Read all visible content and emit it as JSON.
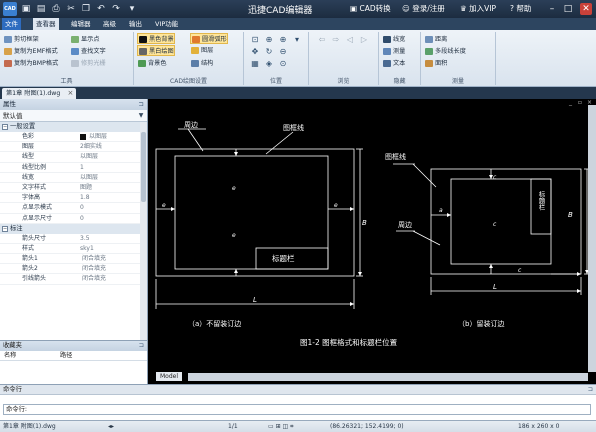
{
  "app": {
    "title": "迅捷CAD编辑器",
    "logo_text": "CAD",
    "title_buttons": [
      "CAD转换",
      "登录/注册",
      "加入VIP",
      "帮助"
    ],
    "window_controls": [
      "minimize-icon",
      "maximize-icon",
      "close-icon"
    ]
  },
  "menu": [
    "文件",
    "查看器",
    "编辑器",
    "高级",
    "输出",
    "VIP功能"
  ],
  "ribbon": {
    "tools": {
      "title": "工具",
      "buttons": [
        "剪切框架",
        "显示点",
        "复制为EMF格式",
        "查找文字",
        "复制为BMP格式",
        "修剪光栅"
      ]
    },
    "cad_settings": {
      "title": "CAD绘图设置",
      "buttons": [
        "黑色背景",
        "圆滑弧形",
        "黑白绘图",
        "图层",
        "背景色",
        "结构"
      ]
    },
    "position": {
      "title": "位置"
    },
    "browse": {
      "title": "浏览"
    },
    "hide": {
      "title": "隐藏",
      "buttons": [
        "线宽",
        "测量",
        "文本"
      ]
    },
    "measure": {
      "title": "测量",
      "buttons": [
        "距离",
        "多段线长度",
        "面积"
      ]
    }
  },
  "doc_tab": "第1章 附图(1).dwg",
  "properties": {
    "title": "属性",
    "selector": "默认值",
    "sections": [
      {
        "name": "一般设置",
        "rows": [
          {
            "key": "色彩",
            "value": "以图层",
            "swatch": true
          },
          {
            "key": "图层",
            "value": "2细实线"
          },
          {
            "key": "线型",
            "value": "以图层"
          },
          {
            "key": "线型比例",
            "value": "1"
          },
          {
            "key": "线宽",
            "value": "以图层"
          },
          {
            "key": "文字样式",
            "value": "图题"
          },
          {
            "key": "字体高",
            "value": "1.8"
          },
          {
            "key": "点显示模式",
            "value": "0"
          },
          {
            "key": "点显示尺寸",
            "value": "0"
          }
        ]
      },
      {
        "name": "标注",
        "rows": [
          {
            "key": "箭头尺寸",
            "value": "3.5"
          },
          {
            "key": "样式",
            "value": "sky1"
          },
          {
            "key": "箭头1",
            "value": "闭合填充"
          },
          {
            "key": "箭头2",
            "value": "闭合填充"
          },
          {
            "key": "引线箭头",
            "value": "闭合填充"
          }
        ]
      }
    ]
  },
  "favorites": {
    "title": "收藏夹",
    "col_name": "名称",
    "col_path": "路径"
  },
  "drawing": {
    "label_a_edge": "周边",
    "label_a_frame": "图框线",
    "label_b_frame": "图框线",
    "label_b_edge": "周边",
    "title_block": "标题栏",
    "title_block_b": "标题栏",
    "caption_a": "（a）不留装订边",
    "caption_b": "（b）留装订边",
    "figure_caption": "图1-2  图框格式和标题栏位置",
    "dim_e": "e",
    "dim_a": "a",
    "dim_c": "c",
    "dim_L": "L",
    "dim_B": "B",
    "model_tab": "Model"
  },
  "command_panel": {
    "title": "命令行",
    "prompt": "命令行:"
  },
  "status": {
    "file": "第1章 附图(1).dwg",
    "page": "1/1",
    "coords": "(86.26321; 152.4199; 0)",
    "size": "186 x 260 x 0"
  }
}
